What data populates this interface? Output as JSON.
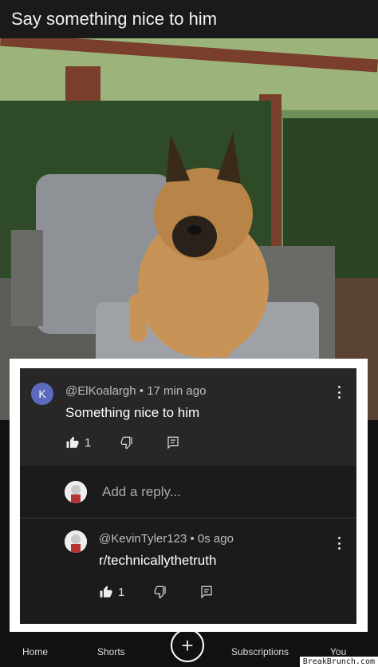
{
  "post": {
    "title": "Say something nice to him"
  },
  "comment": {
    "avatar_letter": "K",
    "avatar_color": "#5c6bc0",
    "author": "@ElKoalargh",
    "time": "17 min ago",
    "text": "Something nice to him",
    "like_count": "1",
    "icons": [
      "thumbs-up-icon",
      "thumbs-down-icon",
      "reply-icon",
      "more-vert-icon"
    ]
  },
  "reply_box": {
    "placeholder": "Add a reply..."
  },
  "reply": {
    "author": "@KevinTyler123",
    "time": "0s ago",
    "text": "r/technicallythetruth",
    "like_count": "1"
  },
  "bottom_nav": {
    "home": "Home",
    "shorts": "Shorts",
    "subscriptions": "Subscriptions",
    "you": "You"
  },
  "watermark": "BreakBrunch.com"
}
